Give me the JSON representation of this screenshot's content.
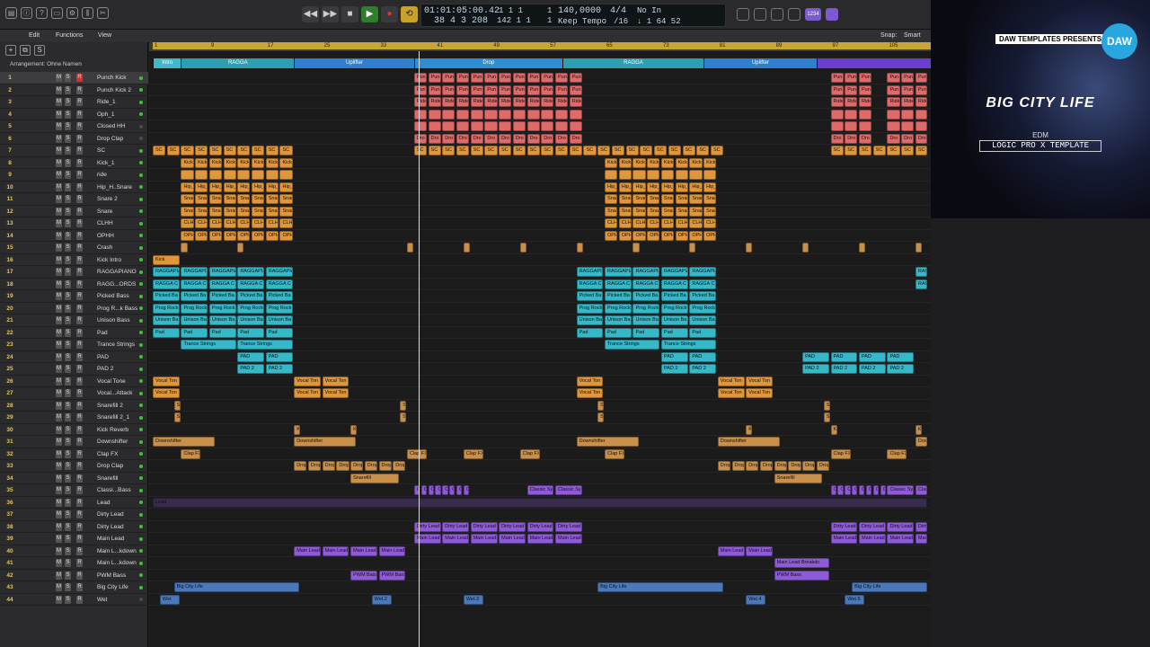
{
  "toolbar": {
    "lcd_time": "01:01:05:00.42",
    "lcd_bars": "38  4  3  208",
    "lcd_pos1": "1   1   1",
    "lcd_pos1b": "1",
    "lcd_pos2": "142  1   1",
    "lcd_pos2b": "1",
    "tempo": "140,0000",
    "tempo_mode": "Keep Tempo",
    "signature": "4/4",
    "division": "/16",
    "midi_in": "No In",
    "midi_out": "↓ 1  64  52",
    "edit_menu": "Edit",
    "functions_menu": "Functions",
    "view_menu": "View",
    "snap_label": "Snap:",
    "snap_value": "Smart",
    "badge": "1234"
  },
  "arrangement_name": "Arrangement: Ohne Namen",
  "ruler_labels": [
    "1",
    "9",
    "17",
    "25",
    "33",
    "41",
    "49",
    "57",
    "65",
    "73",
    "81",
    "89",
    "97",
    "105"
  ],
  "markers": [
    {
      "name": "Intro",
      "color": "#3fb8c8"
    },
    {
      "name": "RAGGA",
      "color": "#2aa0b0"
    },
    {
      "name": "Uplifter",
      "color": "#2f7fd0"
    },
    {
      "name": "Drop",
      "color": "#2c8fd6"
    },
    {
      "name": "RAGGA",
      "color": "#2aa0b0"
    },
    {
      "name": "Uplifter",
      "color": "#2f7fd0"
    },
    {
      "name": "",
      "color": "#6a3fcf"
    }
  ],
  "tracks": [
    {
      "n": "1",
      "name": "Punch Kick",
      "on": true
    },
    {
      "n": "2",
      "name": "Punch Kick 2",
      "on": true
    },
    {
      "n": "3",
      "name": "Ride_1",
      "on": true
    },
    {
      "n": "4",
      "name": "Oph_1",
      "on": true
    },
    {
      "n": "5",
      "name": "Closed HH",
      "on": false
    },
    {
      "n": "6",
      "name": "Drop Clap",
      "on": false
    },
    {
      "n": "7",
      "name": "SC",
      "on": true
    },
    {
      "n": "8",
      "name": "Kick_1",
      "on": true
    },
    {
      "n": "9",
      "name": "ride",
      "on": true
    },
    {
      "n": "10",
      "name": "Hip_H..Snare",
      "on": true
    },
    {
      "n": "11",
      "name": "Snare 2",
      "on": true
    },
    {
      "n": "12",
      "name": "Snare",
      "on": true
    },
    {
      "n": "13",
      "name": "CLHH",
      "on": true
    },
    {
      "n": "14",
      "name": "OPHH",
      "on": true
    },
    {
      "n": "15",
      "name": "Crash",
      "on": true
    },
    {
      "n": "16",
      "name": "Kick Intro",
      "on": true
    },
    {
      "n": "17",
      "name": "RAGGAPIANO",
      "on": true
    },
    {
      "n": "18",
      "name": "RAGG...ORDS",
      "on": true
    },
    {
      "n": "19",
      "name": "Picked Bass",
      "on": true
    },
    {
      "n": "20",
      "name": "Prog R...k Bass",
      "on": true
    },
    {
      "n": "21",
      "name": "Unison Bass",
      "on": true
    },
    {
      "n": "22",
      "name": "Pad",
      "on": true
    },
    {
      "n": "23",
      "name": "Trance Strings",
      "on": true
    },
    {
      "n": "24",
      "name": "PAD",
      "on": true
    },
    {
      "n": "25",
      "name": "PAD 2",
      "on": true
    },
    {
      "n": "26",
      "name": "Vocal Tone",
      "on": true
    },
    {
      "n": "27",
      "name": "Vocal...Attack",
      "on": true
    },
    {
      "n": "28",
      "name": "Snarefill 2",
      "on": true
    },
    {
      "n": "29",
      "name": "Snarefill 2_1",
      "on": true
    },
    {
      "n": "30",
      "name": "Kick Reverb",
      "on": true
    },
    {
      "n": "31",
      "name": "Downshifter",
      "on": true
    },
    {
      "n": "32",
      "name": "Clap FX",
      "on": true
    },
    {
      "n": "33",
      "name": "Drop Clap",
      "on": true
    },
    {
      "n": "34",
      "name": "Snarefill",
      "on": true
    },
    {
      "n": "35",
      "name": "Classi...Bass",
      "on": true
    },
    {
      "n": "36",
      "name": "Lead",
      "on": true
    },
    {
      "n": "37",
      "name": "Dirty Lead",
      "on": true
    },
    {
      "n": "38",
      "name": "Dirty Lead",
      "on": true
    },
    {
      "n": "39",
      "name": "Main Lead",
      "on": true
    },
    {
      "n": "40",
      "name": "Main L...kdown",
      "on": true
    },
    {
      "n": "41",
      "name": "Main L...kdown",
      "on": true
    },
    {
      "n": "42",
      "name": "PWM Bass",
      "on": true
    },
    {
      "n": "43",
      "name": "Big City Life",
      "on": true
    },
    {
      "n": "44",
      "name": "Wet",
      "on": false
    }
  ],
  "region_colors": {
    "red": "#e06a6a",
    "orange": "#e0963a",
    "teal": "#35b8c8",
    "purple": "#8f5ad8",
    "blue": "#4a78b8",
    "tan": "#c8904a"
  },
  "promo": {
    "presenter": "DAW TEMPLATES PRESENTS",
    "logo": "DAW",
    "title": "BIG CITY LIFE",
    "genre": "EDM",
    "product": "LOGIC PRO X TEMPLATE"
  }
}
